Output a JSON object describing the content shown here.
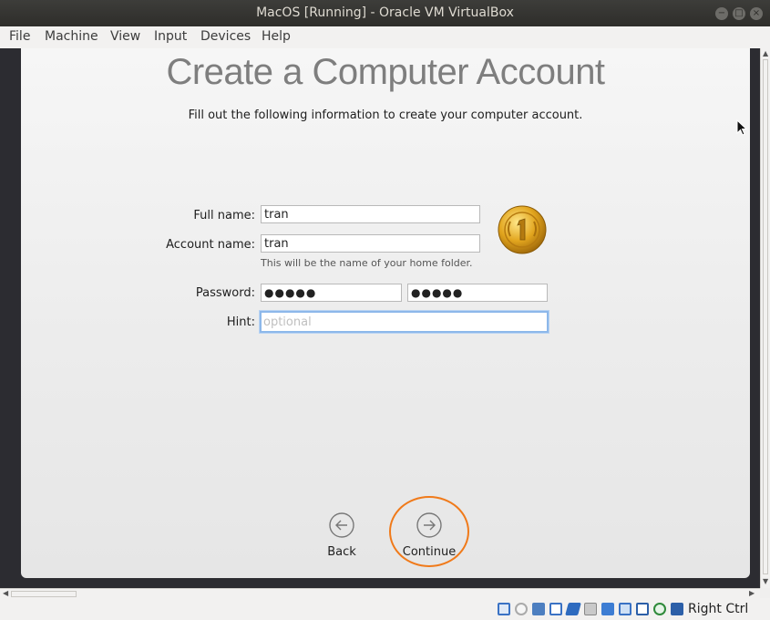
{
  "window": {
    "title": "MacOS [Running] - Oracle VM VirtualBox"
  },
  "menubar": {
    "items": [
      "File",
      "Machine",
      "View",
      "Input",
      "Devices",
      "Help"
    ]
  },
  "setup": {
    "title": "Create a Computer Account",
    "subtitle": "Fill out the following information to create your computer account.",
    "full_name_label": "Full name:",
    "full_name_value": "tran",
    "account_name_label": "Account name:",
    "account_name_value": "tran",
    "account_helper": "This will be the name of your home folder.",
    "password_label": "Password:",
    "password_value": "●●●●●",
    "verify_value": "●●●●●",
    "hint_label": "Hint:",
    "hint_placeholder": "optional",
    "back_label": "Back",
    "continue_label": "Continue"
  },
  "statusbar": {
    "host_key": "Right Ctrl",
    "icons": [
      "hard-disk-icon",
      "optical-drive-icon",
      "audio-icon",
      "network-icon",
      "usb-icon",
      "shared-folders-icon",
      "display-icon",
      "video-capture-icon",
      "recording-icon",
      "cpu-icon",
      "mouse-integration-icon",
      "keyboard-capture-icon"
    ]
  },
  "colors": {
    "highlight": "#f07a1a",
    "focus_ring": "#8db8ea"
  }
}
